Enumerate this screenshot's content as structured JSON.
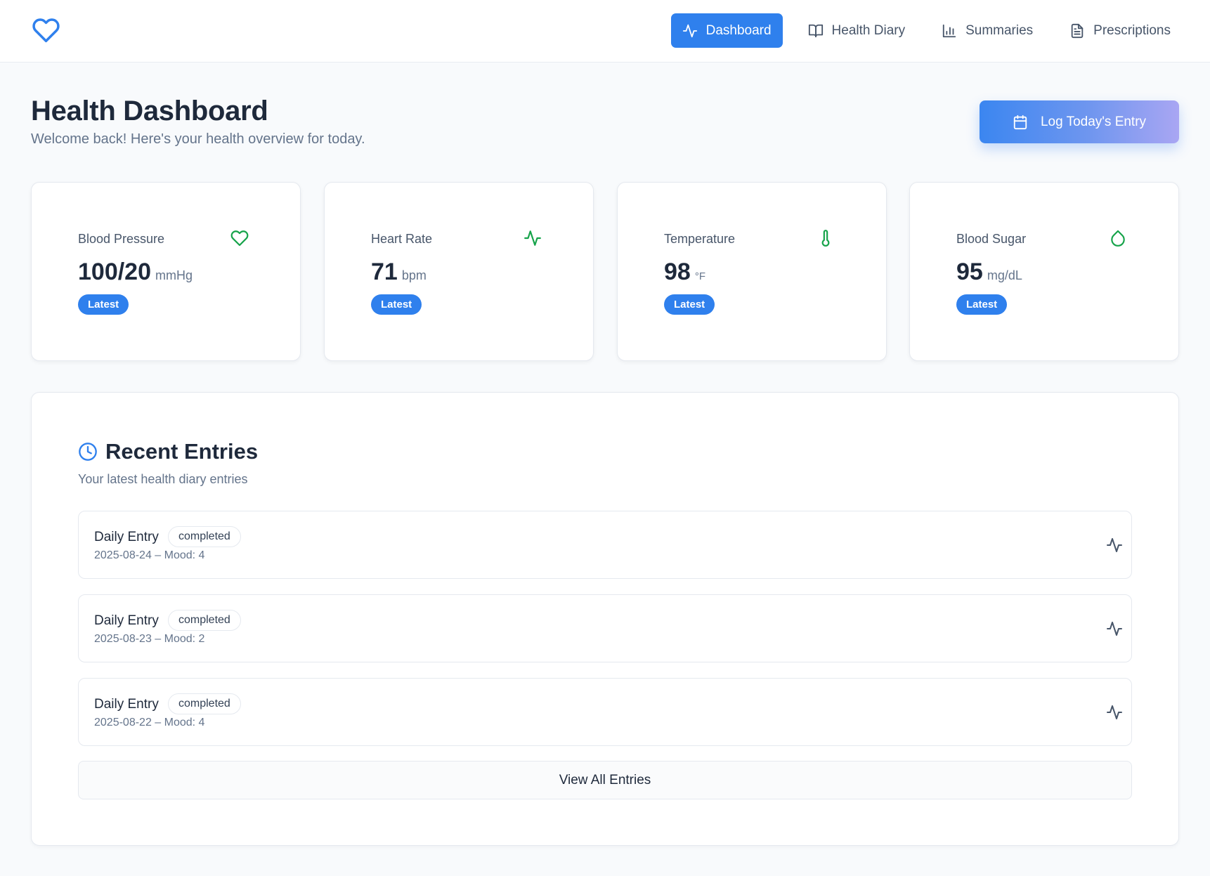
{
  "header": {
    "logo_icon": "heart-icon",
    "nav": [
      {
        "label": "Dashboard",
        "icon": "activity-icon",
        "active": true
      },
      {
        "label": "Health Diary",
        "icon": "book-open-icon",
        "active": false
      },
      {
        "label": "Summaries",
        "icon": "bar-chart-icon",
        "active": false
      },
      {
        "label": "Prescriptions",
        "icon": "file-text-icon",
        "active": false
      }
    ]
  },
  "page": {
    "title": "Health Dashboard",
    "subtitle": "Welcome back! Here's your health overview for today.",
    "log_button": {
      "label": "Log Today's Entry",
      "icon": "calendar-icon"
    }
  },
  "vitals": [
    {
      "label": "Blood Pressure",
      "value": "100/20",
      "unit": "mmHg",
      "badge": "Latest",
      "icon": "heart-icon"
    },
    {
      "label": "Heart Rate",
      "value": "71",
      "unit": "bpm",
      "badge": "Latest",
      "icon": "activity-icon"
    },
    {
      "label": "Temperature",
      "value": "98",
      "unit": "°F",
      "badge": "Latest",
      "icon": "thermometer-icon"
    },
    {
      "label": "Blood Sugar",
      "value": "95",
      "unit": "mg/dL",
      "badge": "Latest",
      "icon": "droplet-icon"
    }
  ],
  "recent": {
    "title": "Recent Entries",
    "subtitle": "Your latest health diary entries",
    "icon": "clock-icon",
    "entries": [
      {
        "title": "Daily Entry",
        "status": "completed",
        "meta": "2025-08-24 – Mood: 4"
      },
      {
        "title": "Daily Entry",
        "status": "completed",
        "meta": "2025-08-23 – Mood: 2"
      },
      {
        "title": "Daily Entry",
        "status": "completed",
        "meta": "2025-08-22 – Mood: 4"
      }
    ],
    "view_all_label": "View All Entries"
  },
  "colors": {
    "primary": "#2f80ed",
    "vital_icon": "#16a34a",
    "page_background": "#f8fafc",
    "text_dark": "#1e293b",
    "text_muted": "#64748b"
  }
}
